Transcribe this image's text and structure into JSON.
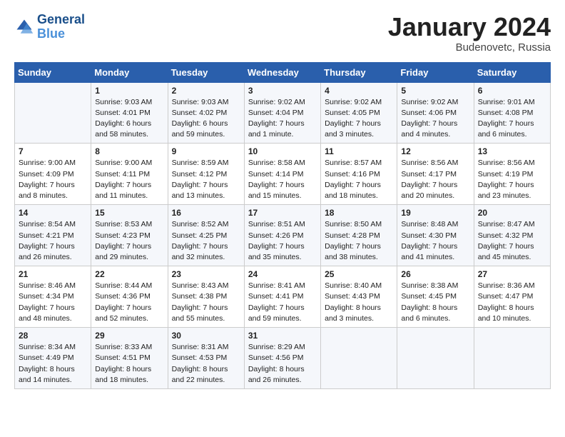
{
  "header": {
    "logo_line1": "General",
    "logo_line2": "Blue",
    "month": "January 2024",
    "location": "Budenovetc, Russia"
  },
  "days_of_week": [
    "Sunday",
    "Monday",
    "Tuesday",
    "Wednesday",
    "Thursday",
    "Friday",
    "Saturday"
  ],
  "weeks": [
    [
      {
        "day": "",
        "content": ""
      },
      {
        "day": "1",
        "content": "Sunrise: 9:03 AM\nSunset: 4:01 PM\nDaylight: 6 hours\nand 58 minutes."
      },
      {
        "day": "2",
        "content": "Sunrise: 9:03 AM\nSunset: 4:02 PM\nDaylight: 6 hours\nand 59 minutes."
      },
      {
        "day": "3",
        "content": "Sunrise: 9:02 AM\nSunset: 4:04 PM\nDaylight: 7 hours\nand 1 minute."
      },
      {
        "day": "4",
        "content": "Sunrise: 9:02 AM\nSunset: 4:05 PM\nDaylight: 7 hours\nand 3 minutes."
      },
      {
        "day": "5",
        "content": "Sunrise: 9:02 AM\nSunset: 4:06 PM\nDaylight: 7 hours\nand 4 minutes."
      },
      {
        "day": "6",
        "content": "Sunrise: 9:01 AM\nSunset: 4:08 PM\nDaylight: 7 hours\nand 6 minutes."
      }
    ],
    [
      {
        "day": "7",
        "content": "Sunrise: 9:00 AM\nSunset: 4:09 PM\nDaylight: 7 hours\nand 8 minutes."
      },
      {
        "day": "8",
        "content": "Sunrise: 9:00 AM\nSunset: 4:11 PM\nDaylight: 7 hours\nand 11 minutes."
      },
      {
        "day": "9",
        "content": "Sunrise: 8:59 AM\nSunset: 4:12 PM\nDaylight: 7 hours\nand 13 minutes."
      },
      {
        "day": "10",
        "content": "Sunrise: 8:58 AM\nSunset: 4:14 PM\nDaylight: 7 hours\nand 15 minutes."
      },
      {
        "day": "11",
        "content": "Sunrise: 8:57 AM\nSunset: 4:16 PM\nDaylight: 7 hours\nand 18 minutes."
      },
      {
        "day": "12",
        "content": "Sunrise: 8:56 AM\nSunset: 4:17 PM\nDaylight: 7 hours\nand 20 minutes."
      },
      {
        "day": "13",
        "content": "Sunrise: 8:56 AM\nSunset: 4:19 PM\nDaylight: 7 hours\nand 23 minutes."
      }
    ],
    [
      {
        "day": "14",
        "content": "Sunrise: 8:54 AM\nSunset: 4:21 PM\nDaylight: 7 hours\nand 26 minutes."
      },
      {
        "day": "15",
        "content": "Sunrise: 8:53 AM\nSunset: 4:23 PM\nDaylight: 7 hours\nand 29 minutes."
      },
      {
        "day": "16",
        "content": "Sunrise: 8:52 AM\nSunset: 4:25 PM\nDaylight: 7 hours\nand 32 minutes."
      },
      {
        "day": "17",
        "content": "Sunrise: 8:51 AM\nSunset: 4:26 PM\nDaylight: 7 hours\nand 35 minutes."
      },
      {
        "day": "18",
        "content": "Sunrise: 8:50 AM\nSunset: 4:28 PM\nDaylight: 7 hours\nand 38 minutes."
      },
      {
        "day": "19",
        "content": "Sunrise: 8:48 AM\nSunset: 4:30 PM\nDaylight: 7 hours\nand 41 minutes."
      },
      {
        "day": "20",
        "content": "Sunrise: 8:47 AM\nSunset: 4:32 PM\nDaylight: 7 hours\nand 45 minutes."
      }
    ],
    [
      {
        "day": "21",
        "content": "Sunrise: 8:46 AM\nSunset: 4:34 PM\nDaylight: 7 hours\nand 48 minutes."
      },
      {
        "day": "22",
        "content": "Sunrise: 8:44 AM\nSunset: 4:36 PM\nDaylight: 7 hours\nand 52 minutes."
      },
      {
        "day": "23",
        "content": "Sunrise: 8:43 AM\nSunset: 4:38 PM\nDaylight: 7 hours\nand 55 minutes."
      },
      {
        "day": "24",
        "content": "Sunrise: 8:41 AM\nSunset: 4:41 PM\nDaylight: 7 hours\nand 59 minutes."
      },
      {
        "day": "25",
        "content": "Sunrise: 8:40 AM\nSunset: 4:43 PM\nDaylight: 8 hours\nand 3 minutes."
      },
      {
        "day": "26",
        "content": "Sunrise: 8:38 AM\nSunset: 4:45 PM\nDaylight: 8 hours\nand 6 minutes."
      },
      {
        "day": "27",
        "content": "Sunrise: 8:36 AM\nSunset: 4:47 PM\nDaylight: 8 hours\nand 10 minutes."
      }
    ],
    [
      {
        "day": "28",
        "content": "Sunrise: 8:34 AM\nSunset: 4:49 PM\nDaylight: 8 hours\nand 14 minutes."
      },
      {
        "day": "29",
        "content": "Sunrise: 8:33 AM\nSunset: 4:51 PM\nDaylight: 8 hours\nand 18 minutes."
      },
      {
        "day": "30",
        "content": "Sunrise: 8:31 AM\nSunset: 4:53 PM\nDaylight: 8 hours\nand 22 minutes."
      },
      {
        "day": "31",
        "content": "Sunrise: 8:29 AM\nSunset: 4:56 PM\nDaylight: 8 hours\nand 26 minutes."
      },
      {
        "day": "",
        "content": ""
      },
      {
        "day": "",
        "content": ""
      },
      {
        "day": "",
        "content": ""
      }
    ]
  ]
}
